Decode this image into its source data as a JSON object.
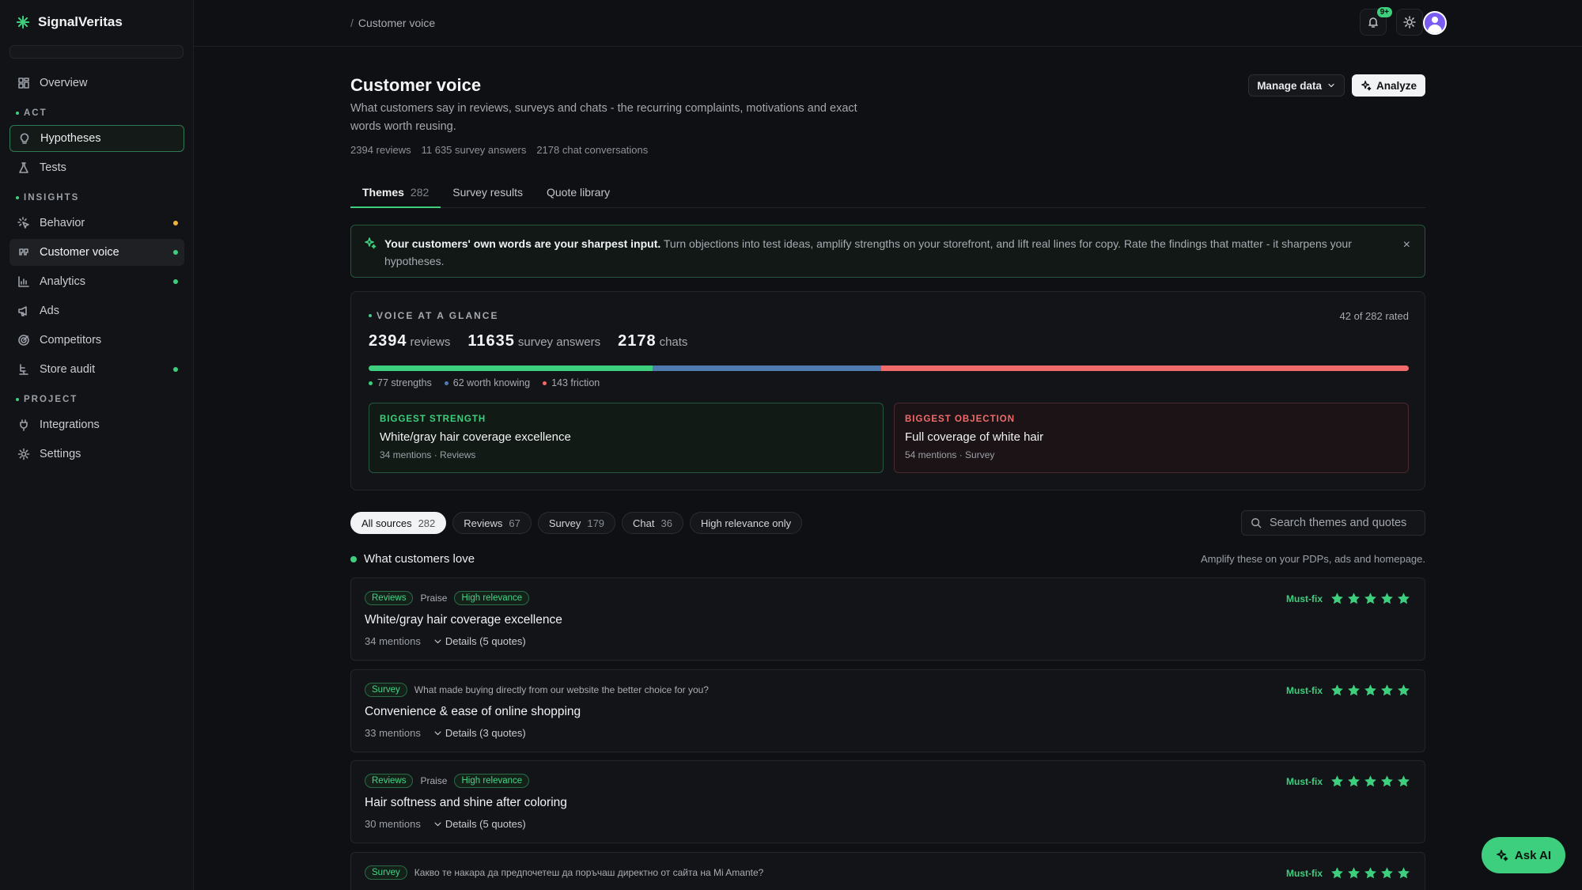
{
  "app": {
    "name": "SignalVeritas"
  },
  "sidebar": {
    "items": [
      {
        "label": "Overview"
      },
      {
        "label": "Hypotheses"
      },
      {
        "label": "Tests"
      },
      {
        "label": "Behavior"
      },
      {
        "label": "Customer voice"
      },
      {
        "label": "Analytics"
      },
      {
        "label": "Ads"
      },
      {
        "label": "Competitors"
      },
      {
        "label": "Store audit"
      },
      {
        "label": "Integrations"
      },
      {
        "label": "Settings"
      }
    ],
    "sections": {
      "act": "ACT",
      "insights": "INSIGHTS",
      "project": "PROJECT"
    },
    "status_colors": {
      "warning": "#f0b43c",
      "ok": "#3ecf7e"
    }
  },
  "topbar": {
    "breadcrumb_sep": "/",
    "breadcrumb": "Customer voice",
    "notifications_badge": "9+"
  },
  "page": {
    "title": "Customer voice",
    "subtitle": "What customers say in reviews, surveys and chats - the recurring complaints, motivations and exact words worth reusing.",
    "counts": {
      "reviews": "2394 reviews",
      "survey": "11 635 survey answers",
      "chats": "2178 chat conversations"
    },
    "buttons": {
      "manage": "Manage data",
      "analyze": "Analyze"
    }
  },
  "tabs": [
    {
      "label": "Themes",
      "count": "282"
    },
    {
      "label": "Survey results"
    },
    {
      "label": "Quote library"
    }
  ],
  "banner": {
    "bold": "Your customers' own words are your sharpest input.",
    "text": " Turn objections into test ideas, amplify strengths on your storefront, and lift real lines for copy. Rate the findings that matter - it sharpens your hypotheses.",
    "close": "×"
  },
  "glance": {
    "label": "VOICE AT A GLANCE",
    "rated": "42 of 282 rated",
    "reviews_n": "2394",
    "reviews_u": "reviews",
    "survey_n": "11635",
    "survey_u": "survey answers",
    "chats_n": "2178",
    "chats_u": "chats",
    "distribution": {
      "strengths": 77,
      "worth_knowing": 62,
      "friction": 143
    },
    "colors": {
      "strengths": "#3ecf7e",
      "worth_knowing": "#4f7bb0",
      "friction": "#f26b6b"
    },
    "legend": {
      "strengths": "77 strengths",
      "worth_knowing": "62 worth knowing",
      "friction": "143 friction"
    },
    "strength": {
      "kicker": "BIGGEST STRENGTH",
      "title": "White/gray hair coverage excellence",
      "meta": "34 mentions · Reviews"
    },
    "objection": {
      "kicker": "BIGGEST OBJECTION",
      "title": "Full coverage of white hair",
      "meta": "54 mentions · Survey"
    }
  },
  "filters": [
    {
      "label": "All sources",
      "count": "282"
    },
    {
      "label": "Reviews",
      "count": "67"
    },
    {
      "label": "Survey",
      "count": "179"
    },
    {
      "label": "Chat",
      "count": "36"
    },
    {
      "label": "High relevance only"
    }
  ],
  "search": {
    "placeholder": "Search themes and quotes"
  },
  "section": {
    "title": "What customers love",
    "hint": "Amplify these on your PDPs, ads and homepage."
  },
  "cards": [
    {
      "source": "Reviews",
      "type": "Praise",
      "relevance": "High relevance",
      "title": "White/gray hair coverage excellence",
      "mentions": "34 mentions",
      "details": "Details (5 quotes)",
      "rating_label": "Must-fix",
      "stars": 5
    },
    {
      "source": "Survey",
      "question": "What made buying directly from our website the better choice for you?",
      "title": "Convenience & ease of online shopping",
      "mentions": "33 mentions",
      "details": "Details (3 quotes)",
      "rating_label": "Must-fix",
      "stars": 5
    },
    {
      "source": "Reviews",
      "type": "Praise",
      "relevance": "High relevance",
      "title": "Hair softness and shine after coloring",
      "mentions": "30 mentions",
      "details": "Details (5 quotes)",
      "rating_label": "Must-fix",
      "stars": 5
    },
    {
      "source": "Survey",
      "question": "Какво те накара да предпочетеш да поръчаш директно от сайта на Mi Amante?",
      "rating_label": "Must-fix",
      "stars": 5
    }
  ],
  "ask_ai": {
    "label": "Ask AI"
  }
}
